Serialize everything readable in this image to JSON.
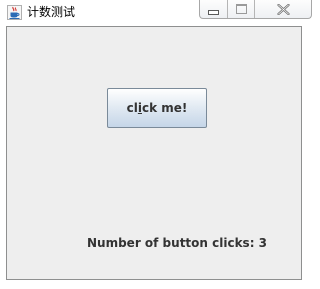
{
  "window": {
    "title": "计数测试",
    "app_icon": "java-cup-icon",
    "controls": {
      "minimize_icon": "minimize-icon",
      "maximize_icon": "maximize-icon",
      "close_icon": "close-icon"
    }
  },
  "content": {
    "button": {
      "label_start": "cl",
      "label_mnemonic": "i",
      "label_end": "ck me!"
    },
    "counter_label": "Number of button clicks: 3"
  },
  "colors": {
    "panel_bg": "#eeeeee",
    "button_gradient_top": "#ffffff",
    "button_gradient_bottom": "#c5d6e8",
    "text": "#333333"
  }
}
